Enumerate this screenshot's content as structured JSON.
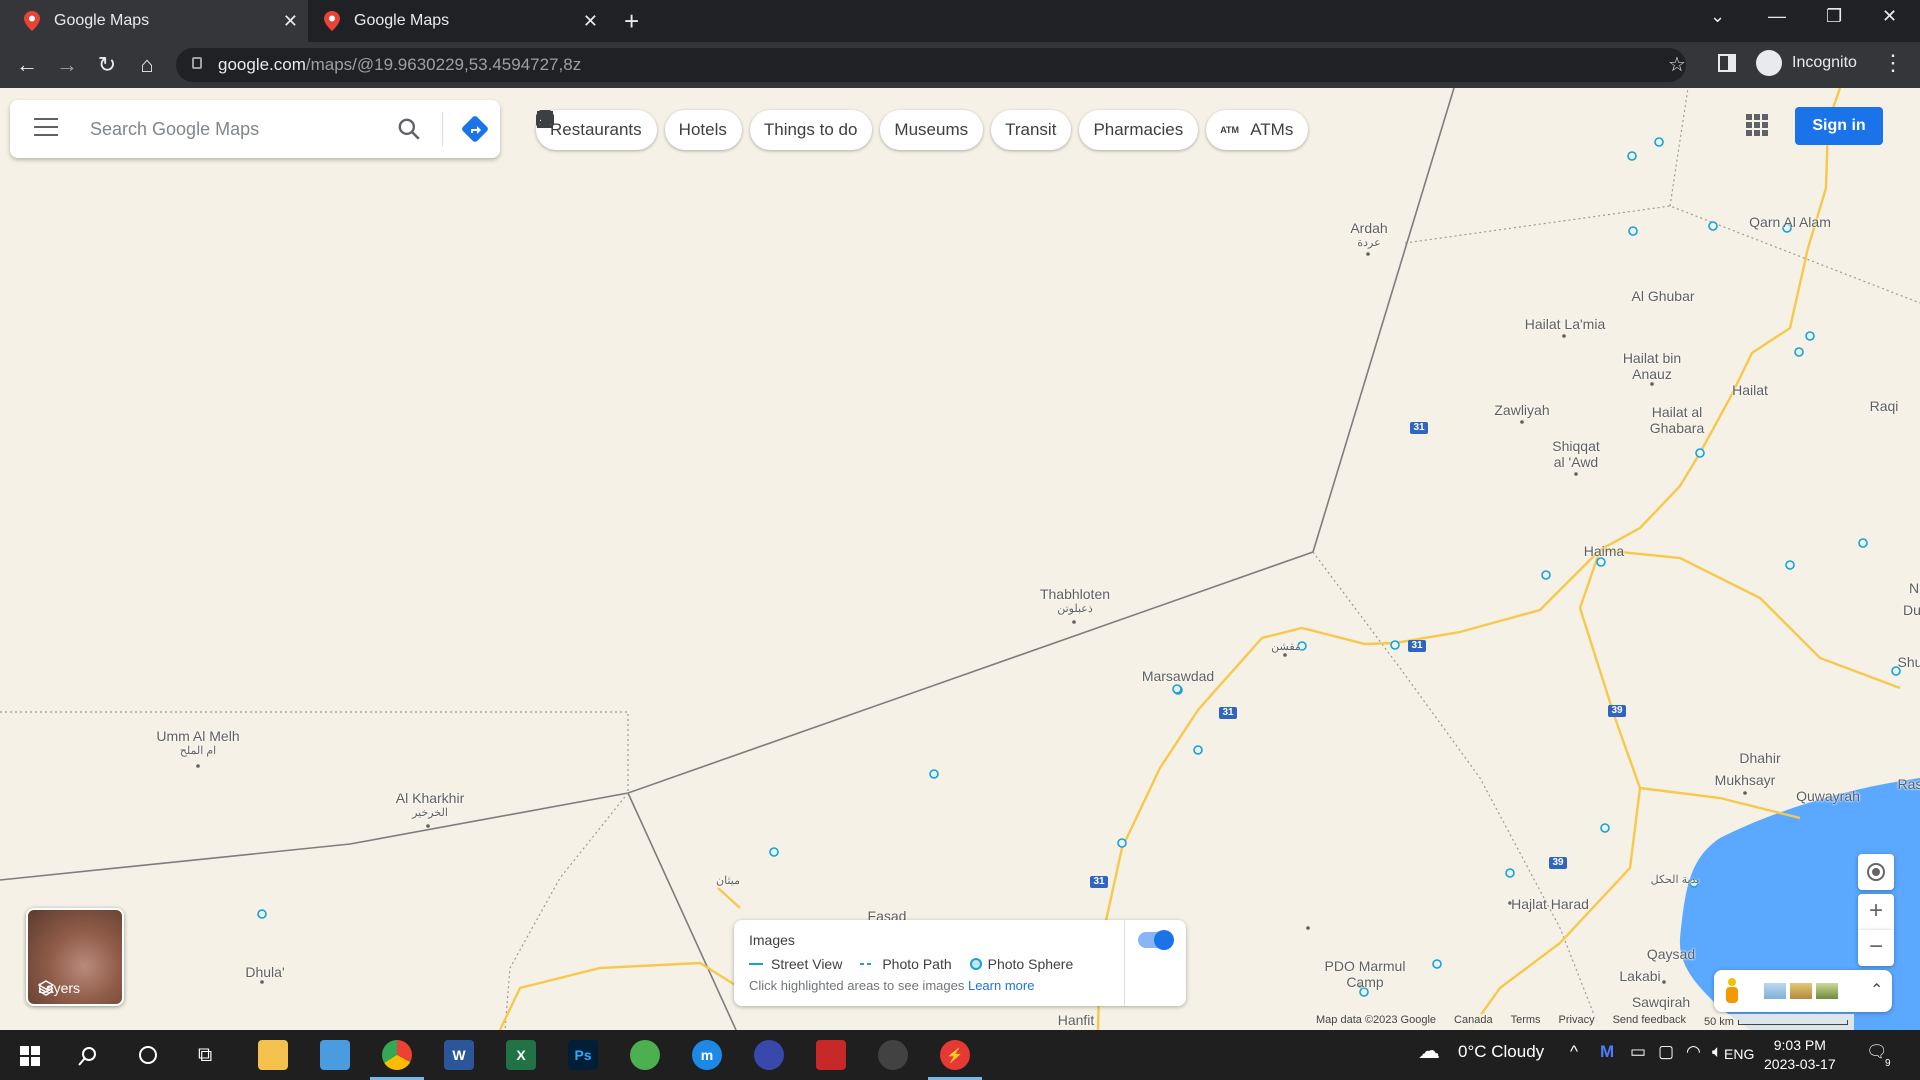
{
  "browser": {
    "tabs": [
      {
        "title": "Google Maps",
        "active": true
      },
      {
        "title": "Google Maps",
        "active": false
      }
    ],
    "url_host": "google.com",
    "url_path": "/maps/@19.9630229,53.4594727,8z",
    "profile_label": "Incognito"
  },
  "search": {
    "placeholder": "Search Google Maps"
  },
  "chips": [
    {
      "label": "Restaurants",
      "icon": "restaurant-icon"
    },
    {
      "label": "Hotels",
      "icon": "hotel-icon"
    },
    {
      "label": "Things to do",
      "icon": "camera-icon"
    },
    {
      "label": "Museums",
      "icon": "museum-icon"
    },
    {
      "label": "Transit",
      "icon": "transit-icon"
    },
    {
      "label": "Pharmacies",
      "icon": "pharmacy-icon"
    },
    {
      "label": "ATMs",
      "icon": "atm-icon"
    }
  ],
  "sign_in_label": "Sign in",
  "places": [
    {
      "name": "Ardah",
      "ar": "عردة"
    },
    {
      "name": "Qarn Al Alam",
      "ar": ""
    },
    {
      "name": "Al Ghubar",
      "ar": ""
    },
    {
      "name": "Hailat La'mia",
      "ar": ""
    },
    {
      "name": "Hailat bin",
      "ar": ""
    },
    {
      "name": "Anauz",
      "ar": ""
    },
    {
      "name": "Zawliyah",
      "ar": ""
    },
    {
      "name": "Hailat",
      "ar": ""
    },
    {
      "name": "Hailat al",
      "ar": ""
    },
    {
      "name": "Ghabara",
      "ar": ""
    },
    {
      "name": "Raqi",
      "ar": ""
    },
    {
      "name": "Shiqqat",
      "ar": ""
    },
    {
      "name": "al 'Awd",
      "ar": ""
    },
    {
      "name": "Haima",
      "ar": ""
    },
    {
      "name": "Thabhloten",
      "ar": "ذعبلوتن"
    },
    {
      "name": "",
      "ar": "مقشن"
    },
    {
      "name": "Marsawdad",
      "ar": ""
    },
    {
      "name": "Umm Al Melh",
      "ar": "ام الملح"
    },
    {
      "name": "Al Kharkhir",
      "ar": "الخرخير"
    },
    {
      "name": "Dhahir",
      "ar": ""
    },
    {
      "name": "Mukhsayr",
      "ar": ""
    },
    {
      "name": "Quwayrah",
      "ar": ""
    },
    {
      "name": "",
      "ar": "ميثان"
    },
    {
      "name": "Fasad",
      "ar": ""
    },
    {
      "name": "Dhula'",
      "ar": ""
    },
    {
      "name": "Hajlat Harad",
      "ar": ""
    },
    {
      "name": "",
      "ar": "بدية الحكل"
    },
    {
      "name": "PDO Marmul",
      "ar": ""
    },
    {
      "name": "Camp",
      "ar": ""
    },
    {
      "name": "Qaysad",
      "ar": ""
    },
    {
      "name": "Lakabi",
      "ar": ""
    },
    {
      "name": "Sawqirah",
      "ar": ""
    },
    {
      "name": "Hanfit",
      "ar": ""
    },
    {
      "name": "N",
      "ar": ""
    },
    {
      "name": "Du",
      "ar": ""
    },
    {
      "name": "Shu",
      "ar": ""
    },
    {
      "name": "Ras",
      "ar": ""
    }
  ],
  "road_shields": [
    "31",
    "31",
    "31",
    "31",
    "39",
    "39"
  ],
  "layers_label": "Layers",
  "images_panel": {
    "title": "Images",
    "street_view": "Street View",
    "photo_path": "Photo Path",
    "photo_sphere": "Photo Sphere",
    "hint": "Click highlighted areas to see images",
    "learn_more": "Learn more"
  },
  "attribution": {
    "map_data": "Map data ©2023 Google",
    "region": "Canada",
    "terms": "Terms",
    "privacy": "Privacy",
    "feedback": "Send feedback",
    "scale": "50 km"
  },
  "taskbar": {
    "weather": "0°C  Cloudy",
    "language": "ENG",
    "time": "9:03 PM",
    "date": "2023-03-17",
    "notifications": "9"
  },
  "colors": {
    "map_land": "#f5f1e6",
    "road": "#f6c84c",
    "sea": "#5aa8ff",
    "accent": "#1a73e8",
    "photo_sphere": "#1a9fd7"
  }
}
